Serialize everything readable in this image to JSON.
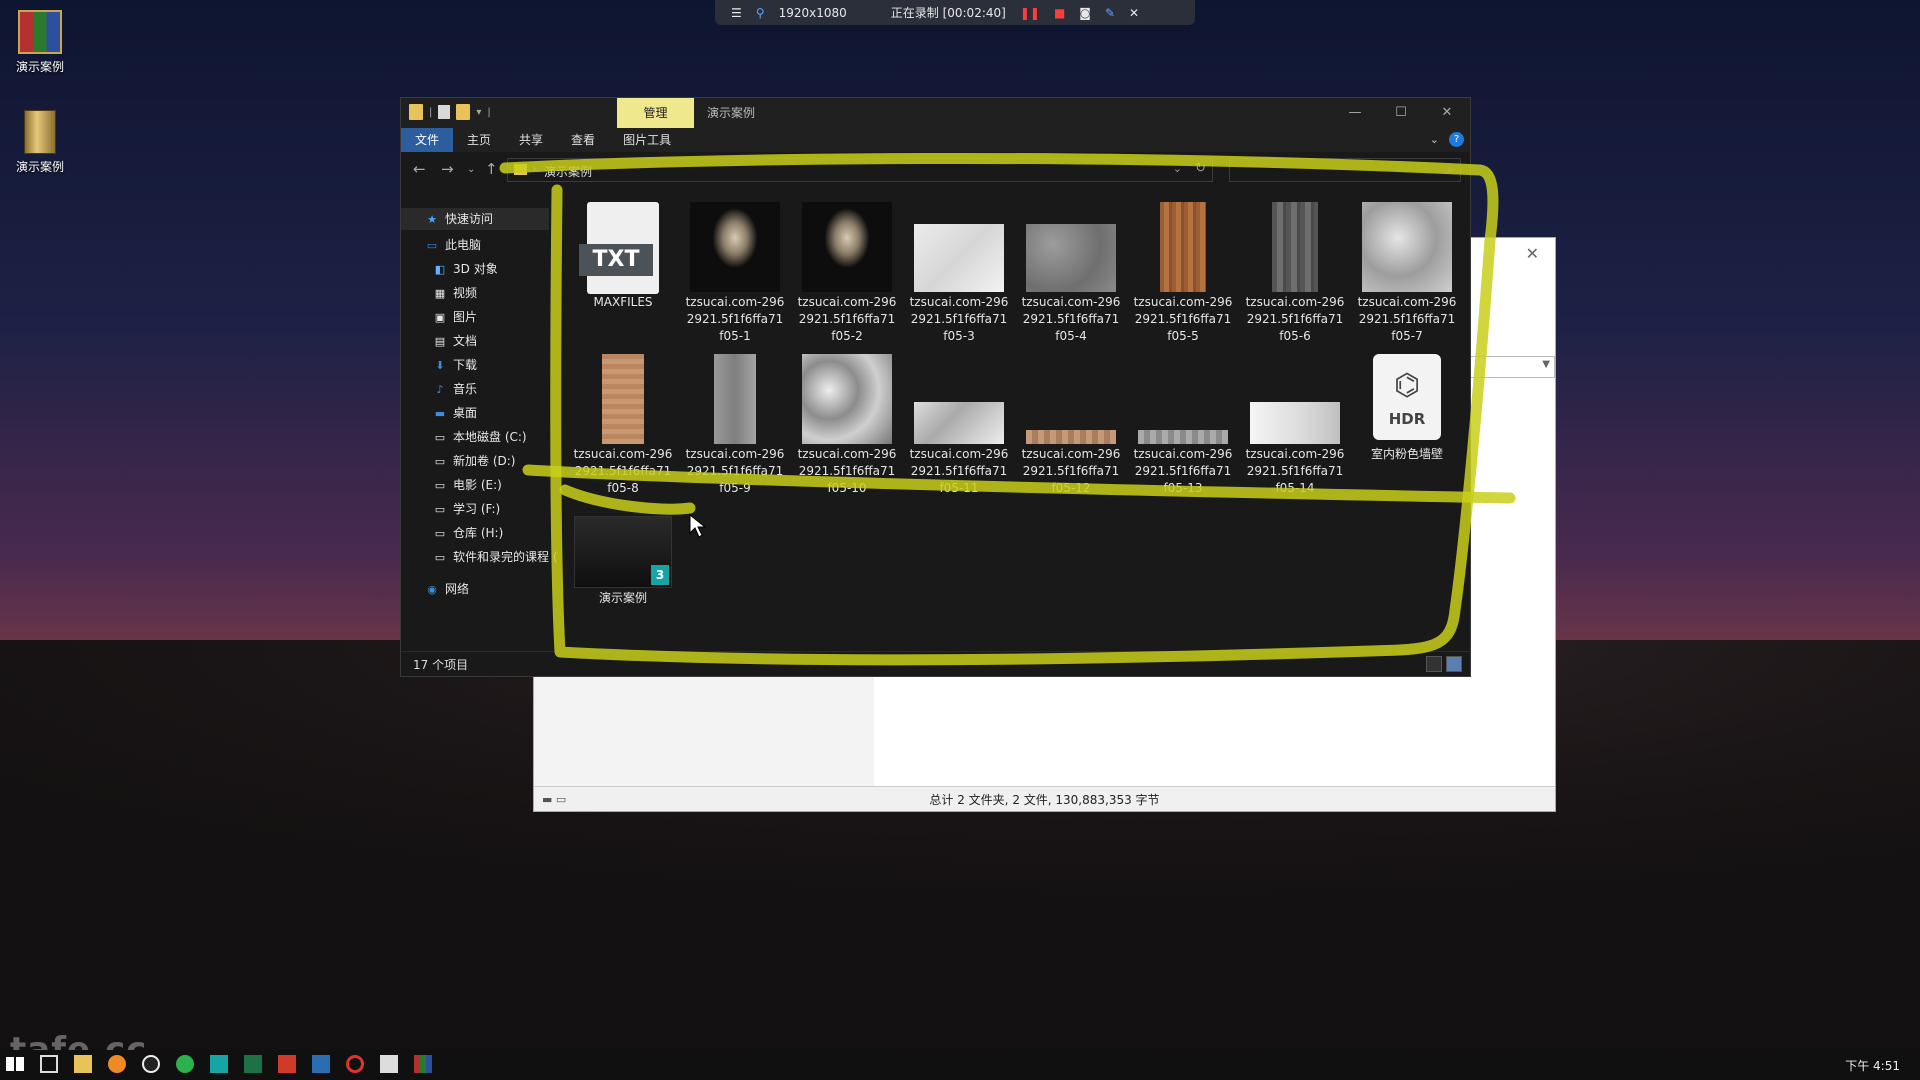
{
  "desktop": {
    "icons": [
      {
        "label": "演示案例",
        "icon": "winrar-archive-icon"
      },
      {
        "label": "演示案例",
        "icon": "zip-archive-icon"
      }
    ],
    "watermark": "tafe.cc"
  },
  "recorder": {
    "resolution": "1920x1080",
    "status": "正在录制 [00:02:40]"
  },
  "background_window": {
    "status_text": "总计 2 文件夹, 2 文件, 130,883,353 字节"
  },
  "explorer": {
    "context_tab": "管理",
    "title": "演示案例",
    "ribbon_tabs": [
      "文件",
      "主页",
      "共享",
      "查看",
      "图片工具"
    ],
    "address_path": "演示案例",
    "search_placeholder": "",
    "sidebar": [
      {
        "label": "快速访问",
        "icon": "star-icon"
      },
      {
        "label": "此电脑",
        "icon": "computer-icon"
      },
      {
        "label": "3D 对象",
        "icon": "cube-icon"
      },
      {
        "label": "视频",
        "icon": "video-icon"
      },
      {
        "label": "图片",
        "icon": "picture-icon"
      },
      {
        "label": "文档",
        "icon": "document-icon"
      },
      {
        "label": "下载",
        "icon": "download-icon"
      },
      {
        "label": "音乐",
        "icon": "music-icon"
      },
      {
        "label": "桌面",
        "icon": "desktop-icon"
      },
      {
        "label": "本地磁盘 (C:)",
        "icon": "drive-icon"
      },
      {
        "label": "新加卷 (D:)",
        "icon": "drive-icon"
      },
      {
        "label": "电影 (E:)",
        "icon": "drive-icon"
      },
      {
        "label": "学习 (F:)",
        "icon": "drive-icon"
      },
      {
        "label": "仓库 (H:)",
        "icon": "drive-icon"
      },
      {
        "label": "软件和录完的课程 (",
        "icon": "drive-icon"
      },
      {
        "label": "网络",
        "icon": "network-icon"
      }
    ],
    "files": [
      {
        "name": "MAXFILES",
        "kind": "txt"
      },
      {
        "name": "tzsucai.com-2962921.5f1f6ffa71f05-1",
        "kind": "reed"
      },
      {
        "name": "tzsucai.com-2962921.5f1f6ffa71f05-2",
        "kind": "reed"
      },
      {
        "name": "tzsucai.com-2962921.5f1f6ffa71f05-3",
        "kind": "marble-l"
      },
      {
        "name": "tzsucai.com-2962921.5f1f6ffa71f05-4",
        "kind": "gray-n"
      },
      {
        "name": "tzsucai.com-2962921.5f1f6ffa71f05-5",
        "kind": "wood"
      },
      {
        "name": "tzsucai.com-2962921.5f1f6ffa71f05-6",
        "kind": "gray-w"
      },
      {
        "name": "tzsucai.com-2962921.5f1f6ffa71f05-7",
        "kind": "silver"
      },
      {
        "name": "tzsucai.com-2962921.5f1f6ffa71f05-8",
        "kind": "wood2"
      },
      {
        "name": "tzsucai.com-2962921.5f1f6ffa71f05-9",
        "kind": "concrete"
      },
      {
        "name": "tzsucai.com-2962921.5f1f6ffa71f05-10",
        "kind": "marble-d"
      },
      {
        "name": "tzsucai.com-2962921.5f1f6ffa71f05-11",
        "kind": "strip-marble"
      },
      {
        "name": "tzsucai.com-2962921.5f1f6ffa71f05-12",
        "kind": "strip-wood"
      },
      {
        "name": "tzsucai.com-2962921.5f1f6ffa71f05-13",
        "kind": "strip-gray"
      },
      {
        "name": "tzsucai.com-2962921.5f1f6ffa71f05-14",
        "kind": "strip-white"
      },
      {
        "name": "室内粉色墙壁",
        "kind": "hdr"
      },
      {
        "name": "演示案例",
        "kind": "max"
      }
    ],
    "txt_label": "TXT",
    "hdr_label": "HDR",
    "max_badge": "3",
    "item_count": "17 个项目"
  },
  "taskbar": {
    "clock": "下午 4:51"
  },
  "colors": {
    "highlighter": "#c8cf1a",
    "ribbon_active": "#2c5d9c",
    "manage_tab": "#efe88d"
  }
}
